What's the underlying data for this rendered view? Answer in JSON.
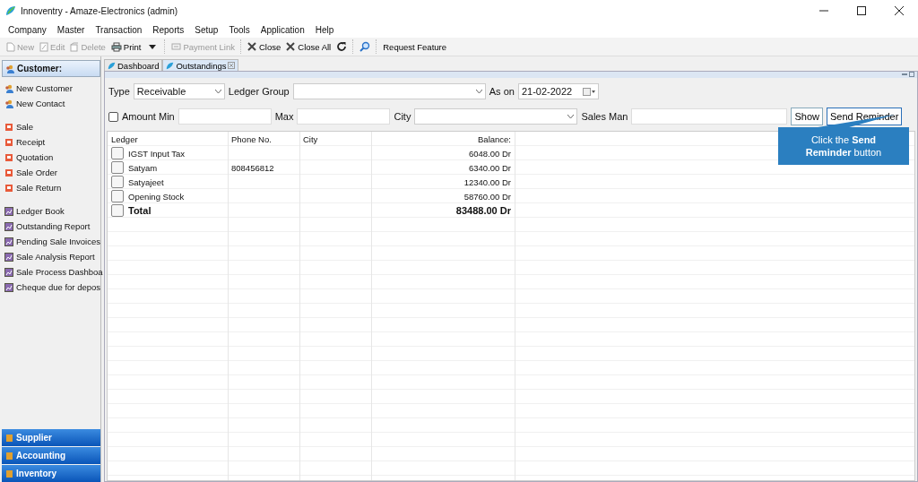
{
  "window": {
    "title": "Innoventry - Amaze-Electronics (admin)"
  },
  "menu": [
    "Company",
    "Master",
    "Transaction",
    "Reports",
    "Setup",
    "Tools",
    "Application",
    "Help"
  ],
  "toolbar": [
    {
      "label": "New",
      "kind": "new",
      "disabled": true
    },
    {
      "label": "Edit",
      "kind": "edit",
      "disabled": true
    },
    {
      "label": "Delete",
      "kind": "delete",
      "disabled": true
    },
    {
      "label": "Print",
      "kind": "print",
      "disabled": false
    },
    {
      "label": "Payment Link",
      "kind": "link",
      "disabled": true
    },
    {
      "label": "Close",
      "kind": "close",
      "disabled": false
    },
    {
      "label": "Close All",
      "kind": "closeall",
      "disabled": false
    },
    {
      "kind": "refresh"
    },
    {
      "kind": "search"
    },
    {
      "label": "Request Feature",
      "kind": "plain",
      "disabled": false
    }
  ],
  "sidebar": {
    "header": "Customer:",
    "sections": [
      {
        "items": [
          "New Customer",
          "New Contact"
        ]
      },
      {
        "items": [
          "Sale",
          "Receipt",
          "Quotation",
          "Sale Order",
          "Sale Return"
        ]
      },
      {
        "items": [
          "Ledger Book",
          "Outstanding Report",
          "Pending Sale Invoices",
          "Sale Analysis Report",
          "Sale Process Dashboa",
          "Cheque due for depos"
        ]
      }
    ],
    "modules": [
      "Supplier",
      "Accounting",
      "Inventory"
    ]
  },
  "tabs": [
    {
      "label": "Dashboard",
      "selected": false
    },
    {
      "label": "Outstandings",
      "selected": true
    }
  ],
  "filters": {
    "type_label": "Type",
    "type_value": "Receivable",
    "ledger_group_label": "Ledger Group",
    "as_on_label": "As on",
    "as_on_value": "21-02-2022",
    "amount_min_label": "Amount Min",
    "amount_min_checked": false,
    "max_label": "Max",
    "city_label": "City",
    "sales_man_label": "Sales Man",
    "show_button": "Show",
    "send_reminder_button": "Send Reminder"
  },
  "table": {
    "columns": [
      "Ledger",
      "Phone No.",
      "City",
      "Balance:"
    ],
    "rows": [
      {
        "ledger": "IGST Input Tax",
        "balance": "6048.00 Dr",
        "checked": false,
        "kind": "normal"
      },
      {
        "ledger": "Satyam",
        "phone": "808456812",
        "balance": "6340.00 Dr",
        "checked": false,
        "kind": "normal"
      },
      {
        "ledger": "Satyajeet",
        "balance": "12340.00 Dr",
        "checked": false,
        "kind": "normal"
      },
      {
        "ledger": "Opening Stock",
        "balance": "58760.00 Dr",
        "checked": false,
        "kind": "normal"
      },
      {
        "ledger": "Total",
        "balance": "83488.00 Dr",
        "checked": false,
        "kind": "total"
      }
    ]
  },
  "callout": {
    "text": "Click the **Send Reminder** button"
  }
}
